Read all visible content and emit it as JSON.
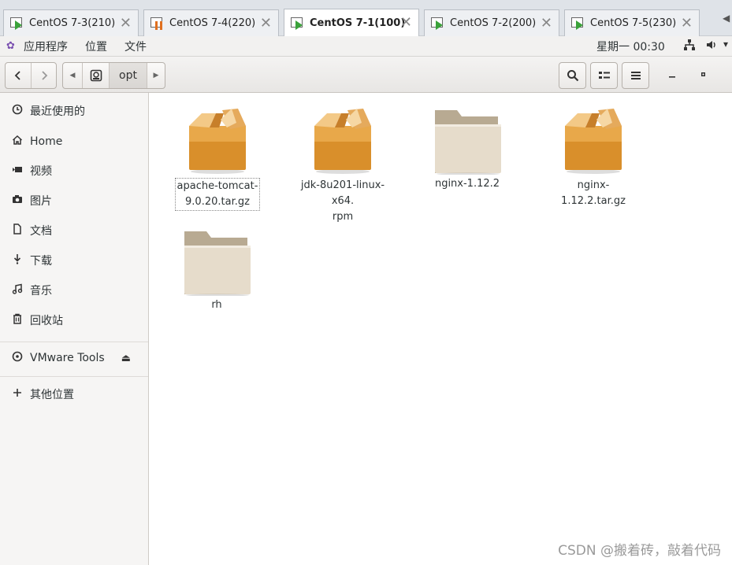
{
  "vm_tabs": [
    {
      "label": "CentOS 7-3(210)",
      "state": "running",
      "active": false
    },
    {
      "label": "CentOS 7-4(220)",
      "state": "paused",
      "active": false
    },
    {
      "label": "CentOS 7-1(100)",
      "state": "running",
      "active": true
    },
    {
      "label": "CentOS 7-2(200)",
      "state": "running",
      "active": false
    },
    {
      "label": "CentOS 7-5(230)",
      "state": "running",
      "active": false
    }
  ],
  "topbar": {
    "menus": [
      "应用程序",
      "位置",
      "文件"
    ],
    "clock": "星期一 00:30"
  },
  "headerbar": {
    "path_current": "opt"
  },
  "sidebar": {
    "items": [
      {
        "label": "最近使用的",
        "icon": "clock-icon"
      },
      {
        "label": "Home",
        "icon": "home-icon"
      },
      {
        "label": "视频",
        "icon": "video-icon"
      },
      {
        "label": "图片",
        "icon": "camera-icon"
      },
      {
        "label": "文档",
        "icon": "document-icon"
      },
      {
        "label": "下载",
        "icon": "download-icon"
      },
      {
        "label": "音乐",
        "icon": "music-icon"
      },
      {
        "label": "回收站",
        "icon": "trash-icon"
      }
    ],
    "device": {
      "label": "VMware Tools",
      "icon": "disc-icon"
    },
    "other": {
      "label": "其他位置",
      "icon": "plus-icon"
    }
  },
  "files": [
    {
      "name_line1": "apache-tomcat-",
      "name_line2": "9.0.20.tar.gz",
      "type": "package",
      "selected": true
    },
    {
      "name_line1": "jdk-8u201-linux-x64.",
      "name_line2": "rpm",
      "type": "package",
      "selected": false
    },
    {
      "name_line1": "nginx-1.12.2",
      "name_line2": "",
      "type": "folder",
      "selected": false
    },
    {
      "name_line1": "nginx-1.12.2.tar.gz",
      "name_line2": "",
      "type": "package",
      "selected": false
    },
    {
      "name_line1": "rh",
      "name_line2": "",
      "type": "folder",
      "selected": false
    }
  ],
  "watermark": "CSDN @搬着砖，敲着代码",
  "colors": {
    "package": "#e0a040",
    "folder": "#e6dccb",
    "play": "#3aa23a",
    "pause": "#e07020"
  }
}
